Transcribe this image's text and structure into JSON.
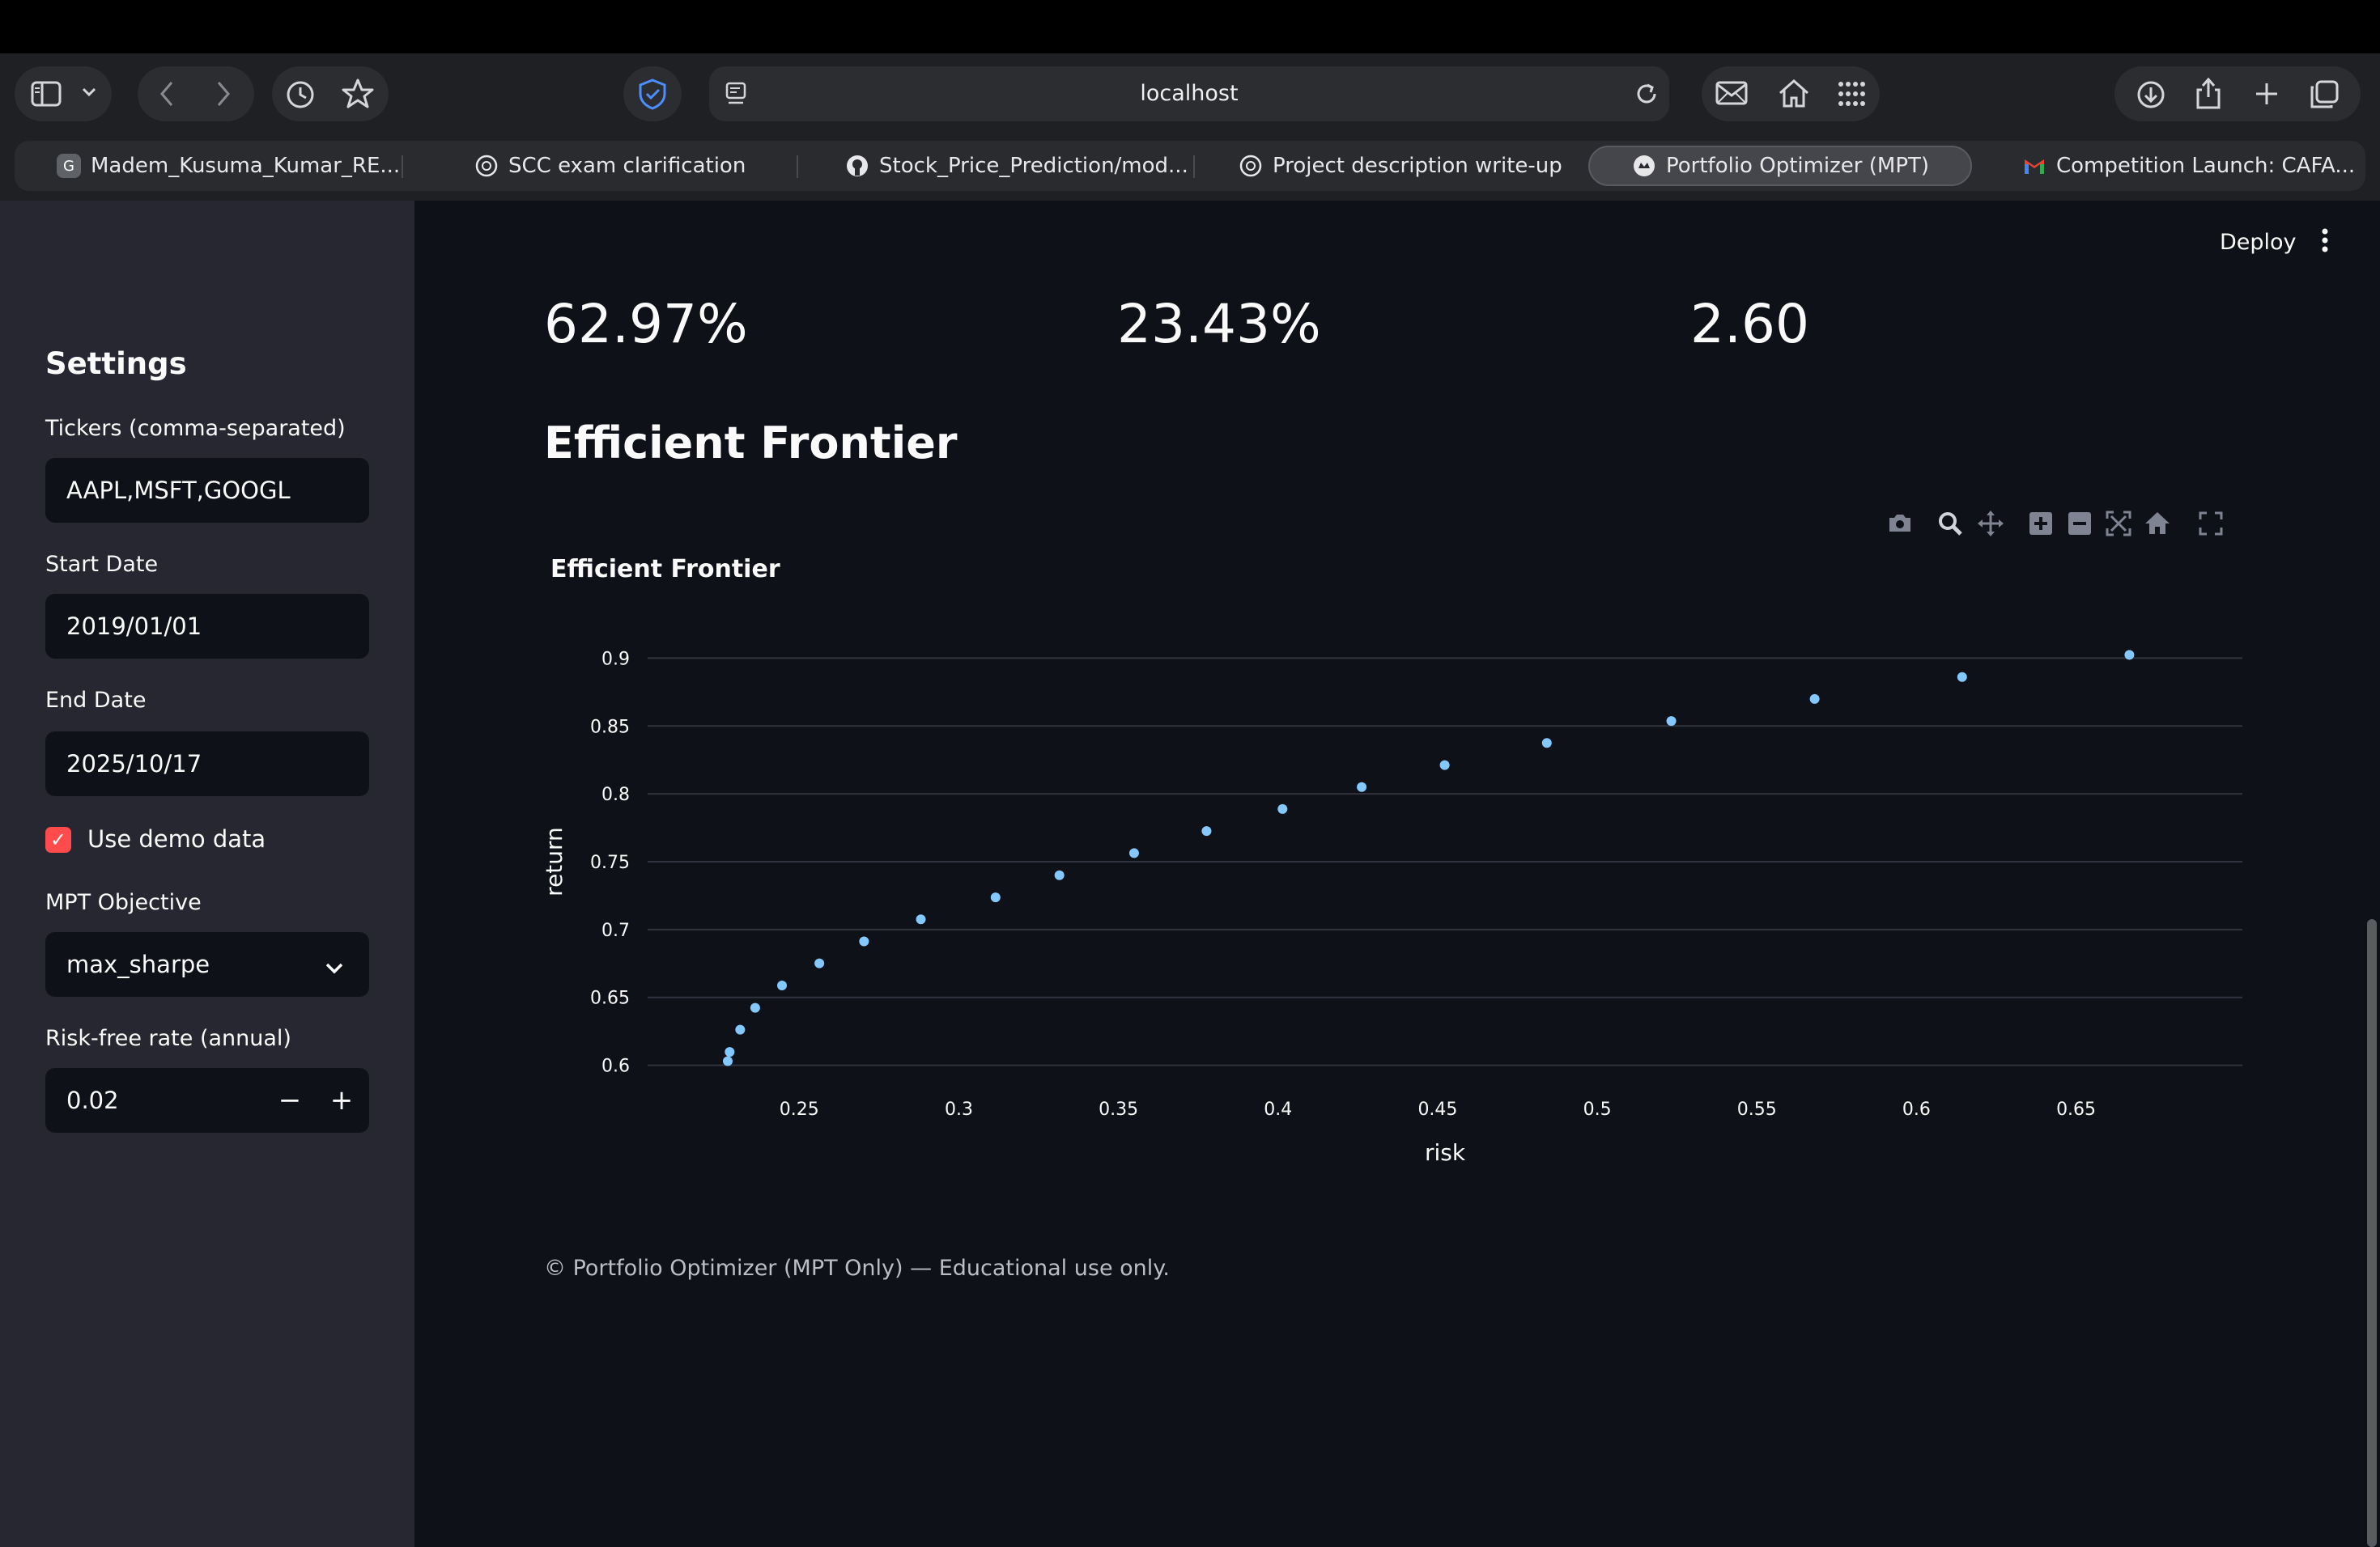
{
  "browser": {
    "url": "localhost",
    "tabs": [
      {
        "label": "Madem_Kusuma_Kumar_RE...",
        "favicon": "G",
        "fav_color": "#5f6368"
      },
      {
        "label": "SCC exam clarification",
        "favicon": "chatgpt-icon",
        "fav_color": "#2a2b2f"
      },
      {
        "label": "Stock_Price_Prediction/mod...",
        "favicon": "github-icon",
        "fav_color": "#2a2b2f"
      },
      {
        "label": "Project description write-up",
        "favicon": "chatgpt-icon",
        "fav_color": "#2a2b2f"
      },
      {
        "label": "Portfolio Optimizer (MPT)",
        "favicon": "streamlit-icon",
        "fav_color": "#2a2b2f",
        "active": true
      },
      {
        "label": "Competition Launch: CAFA...",
        "favicon": "gmail-icon",
        "fav_color": "#2a2b2f"
      }
    ]
  },
  "sidebar": {
    "title": "Settings",
    "tickers_label": "Tickers (comma-separated)",
    "tickers_value": "AAPL,MSFT,GOOGL",
    "start_label": "Start Date",
    "start_value": "2019/01/01",
    "end_label": "End Date",
    "end_value": "2025/10/17",
    "demo_label": "Use demo data",
    "demo_checked": true,
    "objective_label": "MPT Objective",
    "objective_value": "max_sharpe",
    "rf_label": "Risk-free rate (annual)",
    "rf_value": "0.02",
    "minus": "−",
    "plus": "+"
  },
  "header": {
    "deploy": "Deploy"
  },
  "metrics": [
    "62.97%",
    "23.43%",
    "2.60"
  ],
  "section_title": "Efficient Frontier",
  "footer": "© Portfolio Optimizer (MPT Only) — Educational use only.",
  "accent_color": "#ff4b4b",
  "point_color": "#83c9ff",
  "chart_data": {
    "type": "scatter",
    "title": "Efficient Frontier",
    "xlabel": "risk",
    "ylabel": "return",
    "xlim": [
      0.2025,
      0.7021
    ],
    "ylim": [
      0.592,
      0.908
    ],
    "x_ticks": [
      0.25,
      0.3,
      0.35,
      0.4,
      0.45,
      0.5,
      0.55,
      0.6,
      0.65
    ],
    "y_ticks": [
      0.6,
      0.65,
      0.7,
      0.75,
      0.8,
      0.85,
      0.9
    ],
    "grid": true,
    "x": [
      0.2276,
      0.2282,
      0.2315,
      0.2362,
      0.2446,
      0.2563,
      0.2703,
      0.2881,
      0.3115,
      0.3315,
      0.3549,
      0.3776,
      0.4014,
      0.4262,
      0.4522,
      0.4842,
      0.5232,
      0.5681,
      0.6143,
      0.6667
    ],
    "y": [
      0.603,
      0.6098,
      0.6262,
      0.6423,
      0.6588,
      0.6751,
      0.6913,
      0.7075,
      0.7237,
      0.74,
      0.7563,
      0.7726,
      0.7888,
      0.805,
      0.8212,
      0.8375,
      0.8537,
      0.8699,
      0.8861,
      0.9024
    ]
  }
}
